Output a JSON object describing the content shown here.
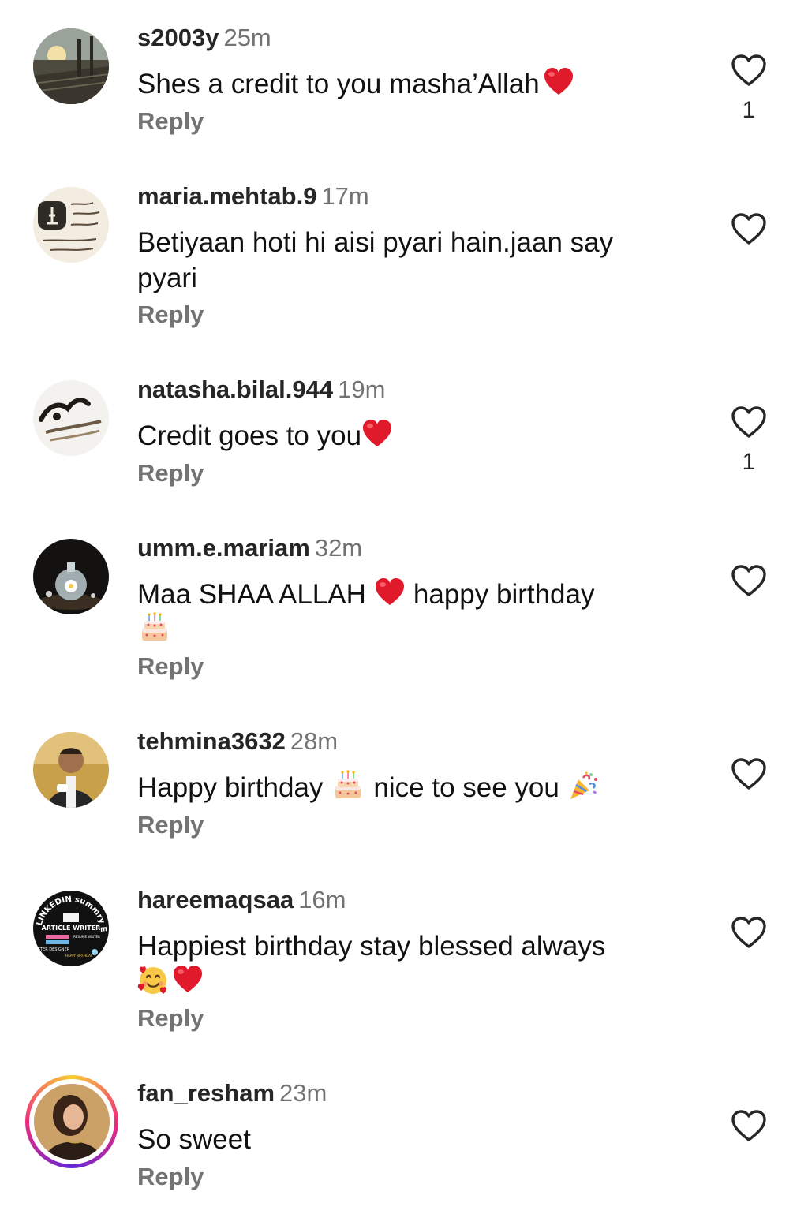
{
  "comments": [
    {
      "username": "s2003y",
      "time": "25m",
      "text": "Shes a credit to you masha’Allah",
      "reply_label": "Reply",
      "likes": "1"
    },
    {
      "username": "maria.mehtab.9",
      "time": "17m",
      "text_line1": "Betiyaan hoti hi aisi pyari hain.jaan say",
      "text_line2": "pyari",
      "reply_label": "Reply"
    },
    {
      "username": "natasha.bilal.944",
      "time": "19m",
      "text": "Credit goes to you",
      "reply_label": "Reply",
      "likes": "1"
    },
    {
      "username": "umm.e.mariam",
      "time": "32m",
      "text_part1": "Maa SHAA ALLAH",
      "text_part2": "happy birthday",
      "reply_label": "Reply"
    },
    {
      "username": "tehmina3632",
      "time": "28m",
      "text_part1": "Happy birthday",
      "text_part2": "nice to see you",
      "reply_label": "Reply"
    },
    {
      "username": "hareemaqsaa",
      "time": "16m",
      "text": "Happiest birthday stay blessed always",
      "reply_label": "Reply",
      "avatar_text": {
        "ring": "LINKEDIN summry EXPERT",
        "title": "ARTICLE WRITER",
        "sub": "RESUME WRITER",
        "bottom": "STER DESIGNER",
        "happy": "HAPPY BIRTHDAY"
      }
    },
    {
      "username": "fan_resham",
      "time": "23m",
      "text": "So sweet",
      "reply_label": "Reply"
    }
  ],
  "icons": {
    "like": "heart-outline-icon",
    "heart_emoji": "red-heart-emoji",
    "cake_emoji": "birthday-cake-emoji",
    "party_emoji": "party-popper-emoji",
    "smiling_hearts_emoji": "smiling-face-with-hearts-emoji"
  },
  "colors": {
    "username": "#262626",
    "secondary": "#737373",
    "heart": "#e0192b",
    "story_ring_start": "#f9ce34",
    "story_ring_mid": "#ee2a7b"
  }
}
